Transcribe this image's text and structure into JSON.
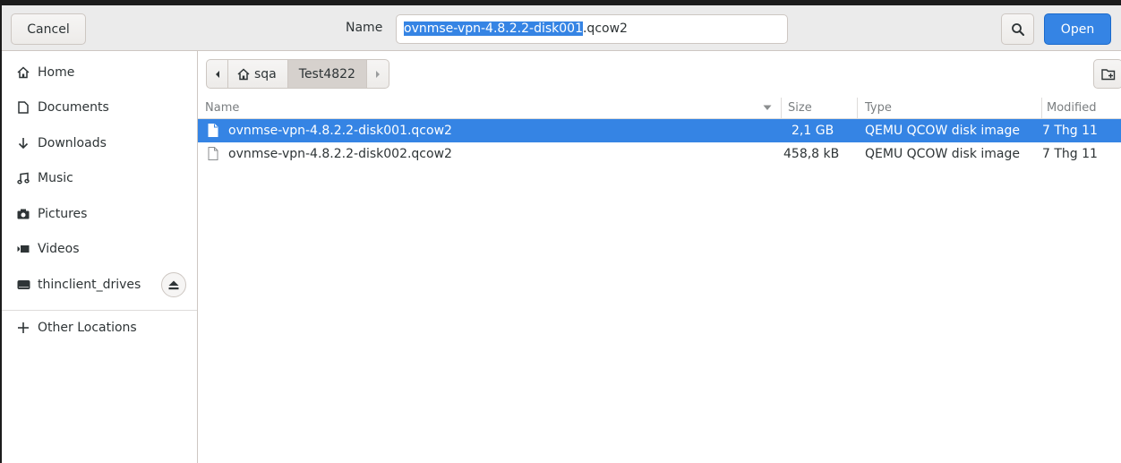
{
  "header": {
    "cancel_label": "Cancel",
    "name_label": "Name",
    "name_value_selected": "ovnmse-vpn-4.8.2.2-disk001",
    "name_value_rest": ".qcow2",
    "open_label": "Open"
  },
  "sidebar": {
    "items": [
      {
        "label": "Home",
        "icon": "home-icon"
      },
      {
        "label": "Documents",
        "icon": "document-icon"
      },
      {
        "label": "Downloads",
        "icon": "download-icon"
      },
      {
        "label": "Music",
        "icon": "music-icon"
      },
      {
        "label": "Pictures",
        "icon": "camera-icon"
      },
      {
        "label": "Videos",
        "icon": "video-icon"
      },
      {
        "label": "thinclient_drives",
        "icon": "drive-icon"
      },
      {
        "label": "Other Locations",
        "icon": "plus-icon"
      }
    ]
  },
  "pathbar": {
    "home_label": "sqa",
    "current_label": "Test4822"
  },
  "file_list": {
    "columns": [
      "Name",
      "Size",
      "Type",
      "Modified"
    ],
    "rows": [
      {
        "name": "ovnmse-vpn-4.8.2.2-disk001.qcow2",
        "size": "2,1 GB",
        "type": "QEMU QCOW disk image",
        "modified": "7 Thg 11",
        "selected": true
      },
      {
        "name": "ovnmse-vpn-4.8.2.2-disk002.qcow2",
        "size": "458,8 kB",
        "type": "QEMU QCOW disk image",
        "modified": "7 Thg 11",
        "selected": false
      }
    ]
  },
  "colors": {
    "accent": "#3584e4",
    "header_bg": "#ebebeb"
  }
}
